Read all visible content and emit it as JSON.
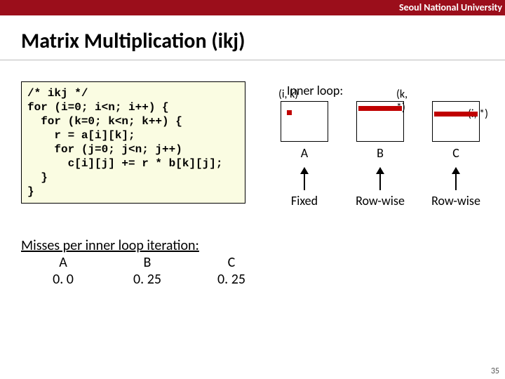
{
  "header": {
    "org": "Seoul National University"
  },
  "title": "Matrix Multiplication (ikj)",
  "code": "/* ikj */\nfor (i=0; i<n; i++) {\n  for (k=0; k<n; k++) {\n    r = a[i][k];\n    for (j=0; j<n; j++)\n      c[i][j] += r * b[k][j];\n  }\n}",
  "diagram": {
    "heading": "Inner loop:",
    "A": {
      "index": "(i, k)",
      "name": "A",
      "access": "Fixed"
    },
    "B": {
      "index": "(k, *)",
      "name": "B",
      "access": "Row-wise"
    },
    "C": {
      "index": "(i, *)",
      "name": "C",
      "access": "Row-wise"
    }
  },
  "misses": {
    "heading": "Misses per inner loop iteration:",
    "cols": {
      "A": "A",
      "B": "B",
      "C": "C"
    },
    "vals": {
      "A": "0. 0",
      "B": "0. 25",
      "C": "0. 25"
    }
  },
  "page": "35"
}
